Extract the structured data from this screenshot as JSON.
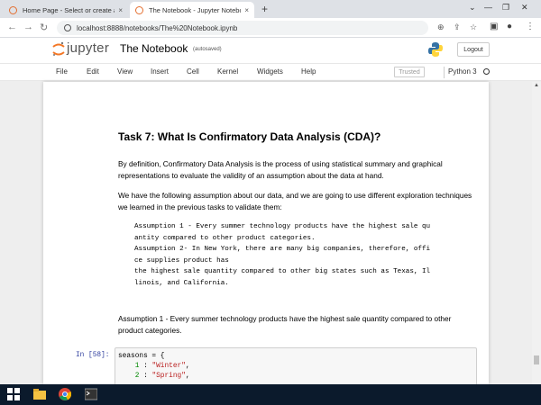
{
  "browser": {
    "tabs": [
      {
        "label": "Home Page - Select or create a n",
        "close": "×"
      },
      {
        "label": "The Notebook - Jupyter Notebo",
        "close": "×"
      }
    ],
    "new_tab": "+",
    "window_controls": [
      "⌄",
      "—",
      "❐",
      "✕"
    ],
    "url": "localhost:8888/notebooks/The%20Notebook.ipynb"
  },
  "jupyter": {
    "logo_text": "jupyter",
    "notebook_name": "The Notebook",
    "autosave": "(autosaved)",
    "logout": "Logout",
    "menu": [
      "File",
      "Edit",
      "View",
      "Insert",
      "Cell",
      "Kernel",
      "Widgets",
      "Help"
    ],
    "trusted": "Trusted",
    "kernel": "Python 3"
  },
  "notebook": {
    "heading": "Task 7: What Is Confirmatory Data Analysis (CDA)?",
    "para1": "By definition, Confirmatory Data Analysis is the process of using statistical summary and graphical representations to evaluate the validity of an assumption about the data at hand.",
    "para2": "We have the following assumption about our data, and we are going to use different exploration techniques we learned in the previous tasks to validate them:",
    "assumption_lines": [
      "Assumption 1 - Every summer technology products have the highest sale qu",
      "antity compared to other product categories.",
      "Assumption 2- In New York, there are many big companies, therefore, offi",
      "ce supplies product has",
      "the highest sale quantity compared to other big states such as Texas, Il",
      "linois, and California."
    ],
    "para3": "Assumption 1 - Every summer technology products have the highest sale quantity compared to other product categories.",
    "prompt": "In [58]:",
    "code": {
      "line1": "seasons = {",
      "line2_num": "1",
      "line2_str": "\"Winter\"",
      "line3_num": "2",
      "line3_str": "\"Spring\""
    }
  }
}
